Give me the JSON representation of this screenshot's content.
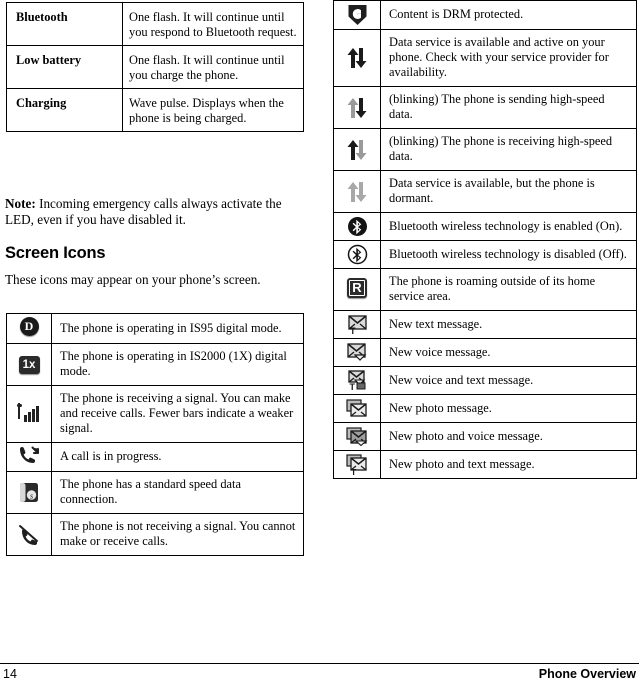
{
  "led_table": {
    "rows": [
      {
        "label": "Bluetooth",
        "desc": "One flash. It will continue until you respond to Bluetooth request."
      },
      {
        "label": "Low battery",
        "desc": "One flash. It will continue until you charge the phone."
      },
      {
        "label": "Charging",
        "desc": "Wave pulse. Displays when the phone is being charged."
      }
    ]
  },
  "note": {
    "prefix": "Note:",
    "text": " Incoming emergency calls always activate the LED, even if you have disabled it."
  },
  "heading": "Screen Icons",
  "lead": "These icons may appear on your phone’s screen.",
  "icons_left": {
    "rows": [
      {
        "icon": "digital-is95-icon",
        "desc": "The phone is operating in IS95 digital mode."
      },
      {
        "icon": "digital-1x-icon",
        "desc": "The phone is operating in IS2000 (1X) digital mode."
      },
      {
        "icon": "signal-strength-icon",
        "desc": "The phone is receiving a signal. You can make and receive calls. Fewer bars indicate a weaker signal."
      },
      {
        "icon": "call-in-progress-icon",
        "desc": "A call is in progress."
      },
      {
        "icon": "standard-speed-data-icon",
        "desc": "The phone has a standard speed data connection."
      },
      {
        "icon": "no-signal-icon",
        "desc": "The phone is not receiving a signal. You cannot make or receive calls."
      }
    ]
  },
  "icons_right": {
    "rows": [
      {
        "icon": "drm-protected-icon",
        "desc": "Content is DRM protected."
      },
      {
        "icon": "data-active-icon",
        "desc": "Data service is available and active on your phone. Check with your service provider for availability."
      },
      {
        "icon": "data-sending-icon",
        "desc": "(blinking) The phone is sending high-speed data."
      },
      {
        "icon": "data-receiving-icon",
        "desc": "(blinking) The phone is receiving high-speed data."
      },
      {
        "icon": "data-dormant-icon",
        "desc": "Data service is available, but the phone is dormant."
      },
      {
        "icon": "bluetooth-on-icon",
        "desc": "Bluetooth wireless technology is enabled (On)."
      },
      {
        "icon": "bluetooth-off-icon",
        "desc": "Bluetooth wireless technology is disabled (Off)."
      },
      {
        "icon": "roaming-icon",
        "desc": "The phone is roaming outside of its home service area."
      },
      {
        "icon": "new-text-message-icon",
        "desc": "New text message."
      },
      {
        "icon": "new-voice-message-icon",
        "desc": "New voice message."
      },
      {
        "icon": "new-voice-text-message-icon",
        "desc": "New voice and text message."
      },
      {
        "icon": "new-photo-message-icon",
        "desc": "New photo message."
      },
      {
        "icon": "new-photo-voice-message-icon",
        "desc": "New photo and voice message."
      },
      {
        "icon": "new-photo-text-message-icon",
        "desc": "New photo and text message."
      }
    ]
  },
  "footer": {
    "page_number": "14",
    "section": "Phone Overview"
  },
  "colors": {
    "ink": "#000000",
    "icon_dark": "#1a1a1a",
    "icon_gray": "#9a9a9a",
    "paper": "#ffffff"
  }
}
